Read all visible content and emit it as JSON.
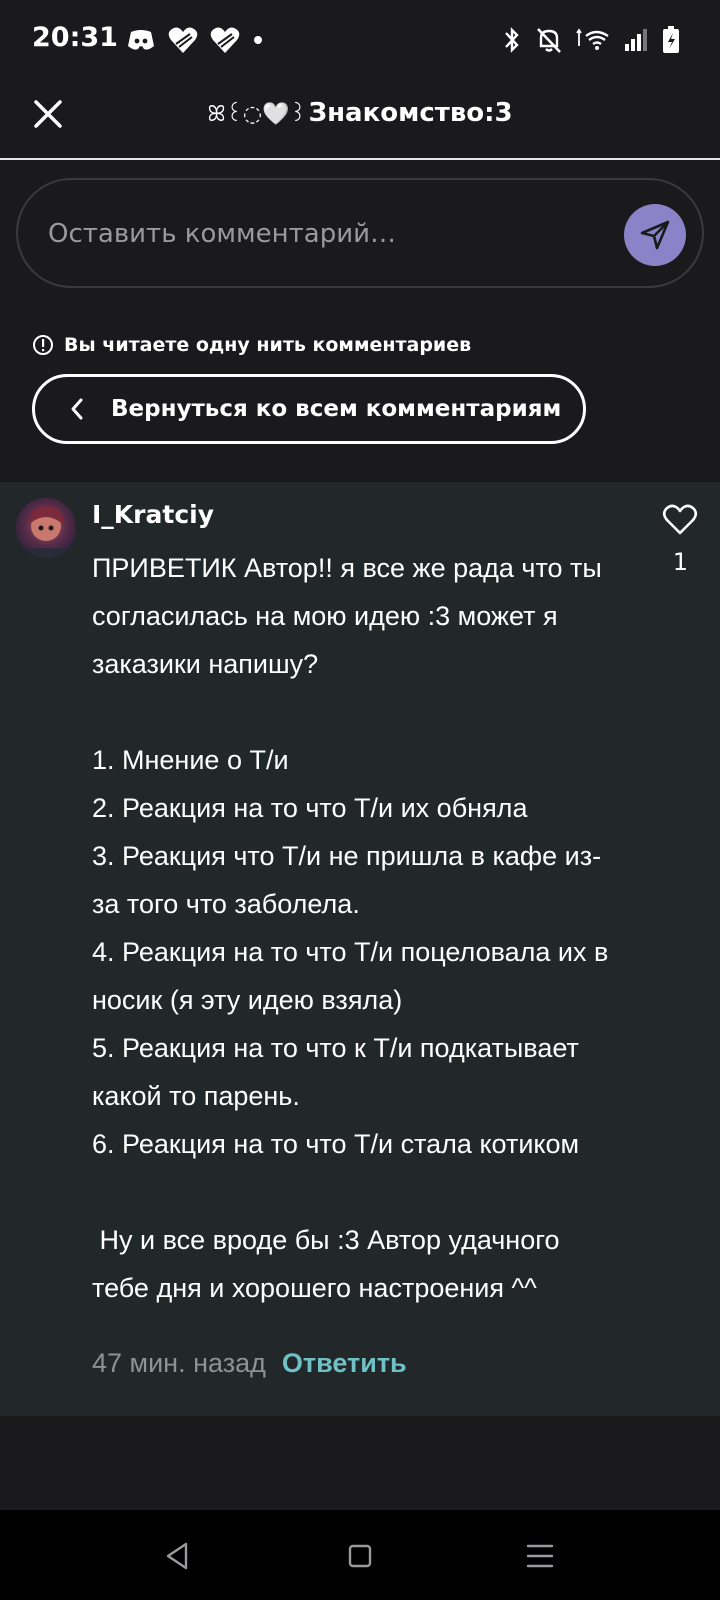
{
  "status_bar": {
    "time": "20:31",
    "left_icons": [
      "discord-icon",
      "heart-icon",
      "heart-icon",
      "dot-icon"
    ],
    "right_icons": [
      "bluetooth-icon",
      "bell-off-icon",
      "wifi-icon",
      "signal-icon",
      "battery-icon"
    ]
  },
  "header": {
    "title_decoration": "ꕤ꒰◌🤍꒱",
    "title": "Знакомство:3"
  },
  "comment_box": {
    "placeholder": "Оставить комментарий…"
  },
  "thread": {
    "info_text": "Вы читаете одну нить комментариев",
    "back_label": "Вернуться ко всем комментариям"
  },
  "comment": {
    "username": "I_Kratciy",
    "text": "ПРИВЕТИК Автор!! я все же рада что ты согласилась на мою идею :3 может я заказики напишу?\n\n1. Мнение о Т/и\n2. Реакция на то что Т/и их обняла\n3. Реакция что Т/и не пришла в кафе из-за того что заболела.\n4. Реакция на то что Т/и поцеловала их в носик (я эту идею взяла)\n5. Реакция на то что к Т/и подкатывает какой то парень.\n6. Реакция на то что Т/и стала котиком\n\n Ну и все вроде бы :3 Автор удачного тебе дня и хорошего настроения ^^",
    "like_count": "1",
    "time": "47 мин. назад",
    "reply_label": "Ответить"
  },
  "colors": {
    "background": "#1a1a1c",
    "card": "#22282a",
    "accent_send": "#8a83c8",
    "reply": "#6fc1c6"
  }
}
